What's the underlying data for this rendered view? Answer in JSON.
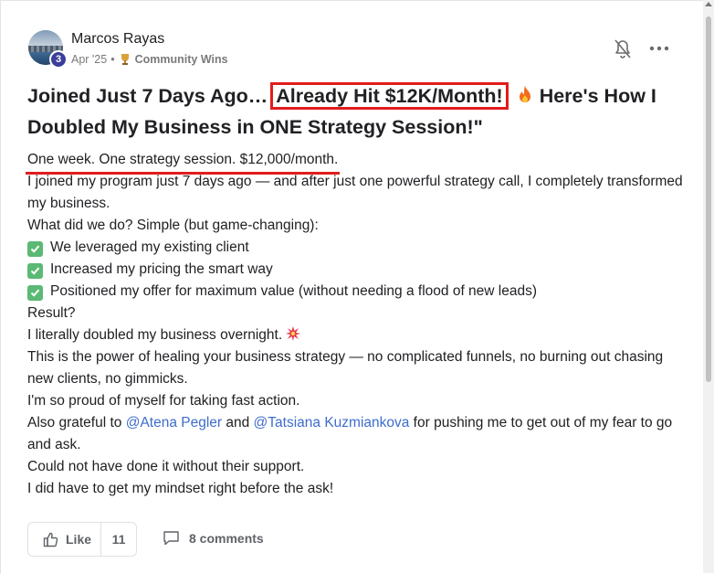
{
  "post": {
    "author": "Marcos Rayas",
    "level": "3",
    "date": "Apr '25",
    "separator": "•",
    "community": "Community Wins",
    "title_part1": "Joined Just 7 Days Ago… ",
    "title_highlight": "Already Hit $12K/Month!",
    "title_part2": "Here's How I Doubled My Business in ONE Strategy Session!\"",
    "lead": "One week. One strategy session. $12,000/month.",
    "p1": "I joined my program just 7 days ago — and after just one powerful strategy call, I completely transformed my business.",
    "p2": "What did we do? Simple (but game-changing):",
    "checks": [
      "We leveraged my existing client",
      "Increased my pricing the smart way",
      "Positioned my offer for maximum value (without needing a flood of new leads)"
    ],
    "p3": "Result?",
    "p4": "I literally doubled my business overnight.",
    "p5": "This is the power of healing your business strategy — no complicated funnels, no burning out chasing new clients, no gimmicks.",
    "p6": "I'm so proud of myself for taking fast action.",
    "p7_a": "Also grateful to ",
    "mention1": "@Atena Pegler",
    "p7_b": " and ",
    "mention2": "@Tatsiana Kuzmiankova",
    "p7_c": " for pushing me to get out of my fear to go and ask.",
    "p8": "Could not have done it without their support.",
    "p9": "I did have to get my mindset right before the ask!"
  },
  "actions": {
    "like_label": "Like",
    "like_count": "11",
    "comments_label": "8 comments"
  },
  "icons": {
    "bell": "bell-off-icon",
    "more": "more-horizontal-icon",
    "fire": "fire-icon",
    "check": "check-box-icon",
    "burst": "collision-icon",
    "trophy": "trophy-icon",
    "thumb": "thumbs-up-icon",
    "comment": "comment-icon"
  },
  "colors": {
    "highlight": "#e11d1d",
    "mention": "#3d6dcc",
    "check": "#5bb974",
    "level_badge": "#3b3f9a"
  }
}
